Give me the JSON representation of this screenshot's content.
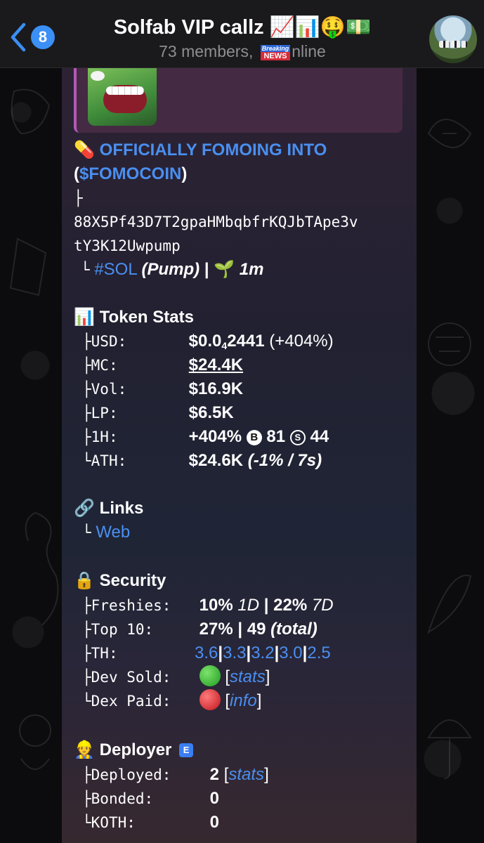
{
  "header": {
    "back_count": "8",
    "title": "Solfab VIP callz 📈📊🤑💵",
    "subtitle_pre": "73 members, ",
    "news_top": "Breaking",
    "news_bottom": "NEWS",
    "subtitle_post": "nline"
  },
  "message": {
    "headline_emoji": "💊",
    "headline": "OFFICIALLY FOMOING INTO",
    "ticker_open": "(",
    "ticker": "$FOMOCOIN",
    "ticker_close": ")",
    "tree_top": "├",
    "address_line1": "88X5Pf43D7T2gpaHMbqbfrKQJbTApe3v",
    "address_line2": "tY3K12Uwpump",
    "chain_branch": "└",
    "chain_tag": "#SOL",
    "chain_platform": "(Pump)",
    "chain_sep": "|",
    "age_emoji": "🌱",
    "age": "1m",
    "token_stats": {
      "emoji": "📊",
      "title": "Token Stats",
      "rows": [
        {
          "branch": "├",
          "key": "USD:",
          "value_main": "$0.0",
          "value_sub": "4",
          "value_rest": "2441",
          "value_extra": "(+404%)"
        },
        {
          "branch": "├",
          "key": "MC:",
          "value": "$24.4K"
        },
        {
          "branch": "├",
          "key": "Vol:",
          "value": "$16.9K"
        },
        {
          "branch": "├",
          "key": "LP:",
          "value": "$6.5K"
        },
        {
          "branch": "├",
          "key": "1H:",
          "value": "+404%",
          "b_icon": "B",
          "b_value": "81",
          "s_icon": "S",
          "s_value": "44"
        },
        {
          "branch": "└",
          "key": "ATH:",
          "value": "$24.6K",
          "value_extra": "(-1% / 7s)"
        }
      ]
    },
    "links": {
      "emoji": "🔗",
      "title": "Links",
      "branch": "└",
      "web": "Web"
    },
    "security": {
      "emoji": "🔒",
      "title": "Security",
      "freshies_key": "Freshies:",
      "freshies_1": "10%",
      "freshies_1_period": "1D",
      "freshies_sep": "|",
      "freshies_2": "22%",
      "freshies_2_period": "7D",
      "top10_key": "Top 10:",
      "top10_pct": "27%",
      "top10_sep": "|",
      "top10_count": "49",
      "top10_note": "(total)",
      "th_key": "TH:",
      "th_values": [
        "3.6",
        "3.3",
        "3.2",
        "3.0",
        "2.5"
      ],
      "th_sep": "|",
      "dev_sold_key": "Dev Sold:",
      "dev_sold_link": "stats",
      "dex_paid_key": "Dex Paid:",
      "dex_paid_link": "info",
      "bracket_open": "[",
      "bracket_close": "]",
      "branch_mid": "├",
      "branch_end": "└"
    },
    "deployer": {
      "emoji": "👷",
      "title": "Deployer",
      "badge": "E",
      "deployed_key": "Deployed:",
      "deployed_value": "2",
      "deployed_link": "stats",
      "bonded_key": "Bonded:",
      "bonded_value": "0",
      "koth_key": "KOTH:",
      "koth_value": "0"
    }
  },
  "colors": {
    "link": "#4a8ff0",
    "header_bg": "#1a1a1c",
    "badge": "#3b8ff5"
  }
}
